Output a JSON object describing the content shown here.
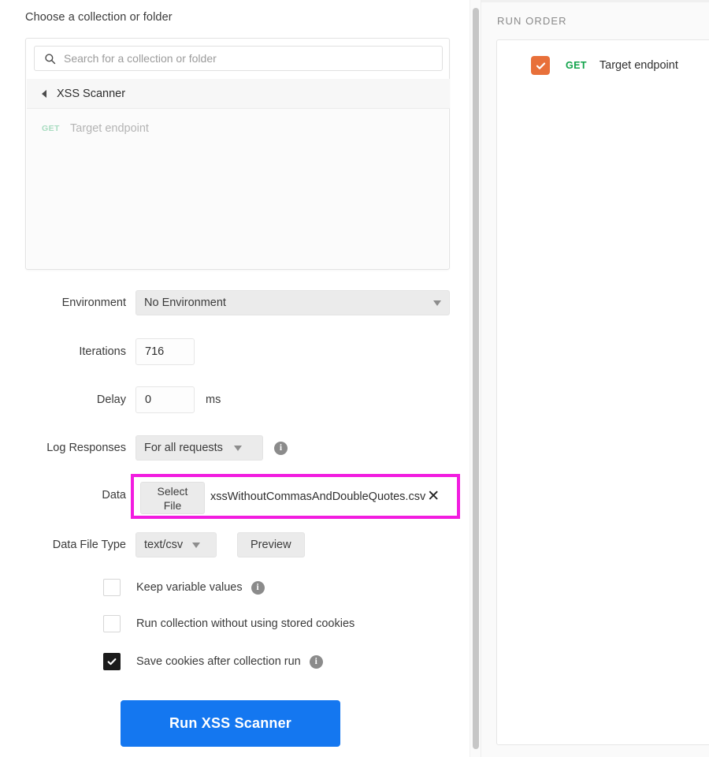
{
  "left": {
    "section_heading": "Choose a collection or folder",
    "search": {
      "placeholder": "Search for a collection or folder",
      "value": "",
      "icon": "search-icon"
    },
    "breadcrumb": {
      "back_icon": "back-caret-icon",
      "label": "XSS Scanner"
    },
    "collection_items": [
      {
        "method": "GET",
        "name": "Target endpoint"
      }
    ],
    "fields": {
      "environment_label": "Environment",
      "environment_value": "No Environment",
      "iterations_label": "Iterations",
      "iterations_value": "716",
      "delay_label": "Delay",
      "delay_value": "0",
      "delay_unit": "ms",
      "log_responses_label": "Log Responses",
      "log_responses_value": "For all requests",
      "data_label": "Data",
      "select_file_line1": "Select",
      "select_file_line2": "File",
      "data_file_name": "xssWithoutCommasAndDoubleQuotes.csv",
      "data_file_clear": "✕",
      "data_file_type_label": "Data File Type",
      "data_file_type_value": "text/csv",
      "preview_label": "Preview"
    },
    "checkboxes": [
      {
        "label": "Keep variable values",
        "checked": false,
        "info": true
      },
      {
        "label": "Run collection without using stored cookies",
        "checked": false,
        "info": false
      },
      {
        "label": "Save cookies after collection run",
        "checked": true,
        "info": true
      }
    ],
    "run_button_label": "Run XSS Scanner",
    "info_icon_glyph": "i"
  },
  "right": {
    "title": "RUN ORDER",
    "items": [
      {
        "method": "GET",
        "name": "Target endpoint",
        "checked": true
      }
    ]
  },
  "colors": {
    "highlight": "#f21ce0",
    "run_button": "#1477f0",
    "orange_check": "#e8703a",
    "method_green": "#10a34a",
    "method_green_muted": "#a8dcc0"
  }
}
